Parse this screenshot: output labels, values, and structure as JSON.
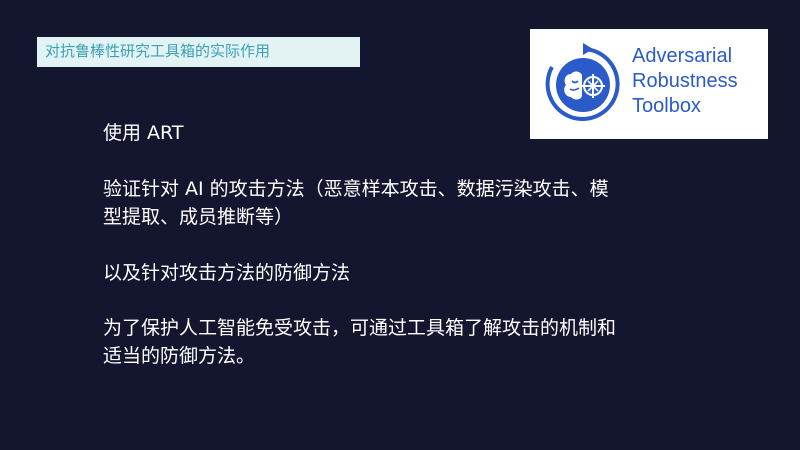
{
  "slide": {
    "title": "对抗鲁棒性研究工具箱的实际作用",
    "logo": {
      "lines": [
        "Adversarial",
        "Robustness",
        "Toolbox"
      ],
      "icon": "brain-target-icon",
      "color": "#2b5bc8"
    },
    "paragraphs": {
      "p1": "使用 ART",
      "p2_line1": "验证针对 AI 的攻击方法（恶意样本攻击、数据污染攻击、模",
      "p2_line2": "型提取、成员推断等）",
      "p3": "以及针对攻击方法的防御方法",
      "p4_line1": "为了保护人工智能免受攻击，可通过工具箱了解攻击的机制和",
      "p4_line2": "适当的防御方法。"
    },
    "colors": {
      "background": "#14152e",
      "title_bg": "#e3f3f4",
      "title_text": "#3a9fb8",
      "body_text": "#ffffff"
    }
  }
}
